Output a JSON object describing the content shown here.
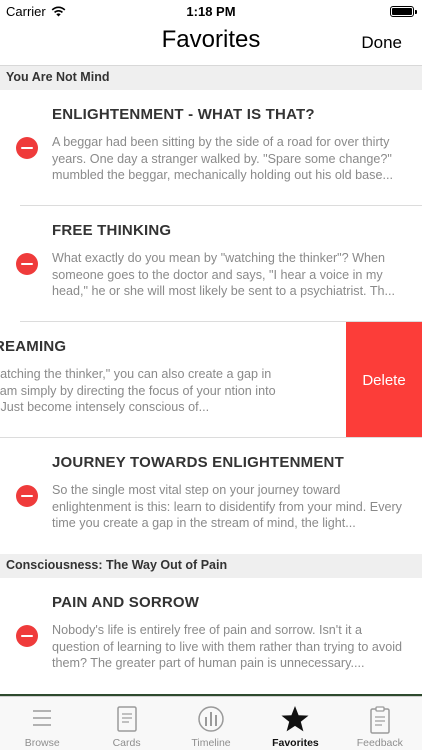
{
  "status": {
    "carrier": "Carrier",
    "time": "1:18 PM"
  },
  "nav": {
    "title": "Favorites",
    "done_label": "Done"
  },
  "sections": [
    {
      "header": "You Are Not Mind",
      "rows": [
        {
          "title": "ENLIGHTENMENT - WHAT IS THAT?",
          "text": "A beggar had been sitting by the side of a road for over thirty years. One day a stranger walked by. \"Spare some change?\" mumbled the beggar, mechanically holding out his old base..."
        },
        {
          "title": "FREE THINKING",
          "text": "What exactly do you mean by \"watching the thinker\"? When someone goes to the doctor and says, \"I hear a voice in my head,\" he or she will most likely be sent to a psychiatrist. Th..."
        },
        {
          "title": "ND STREAMING",
          "text": "ead of \"watching the thinker,\" you can also create a gap in mind stream simply by directing the focus of your ntion into the Now. Just become intensely conscious of...",
          "delete_label": "Delete"
        },
        {
          "title": "JOURNEY TOWARDS ENLIGHTENMENT",
          "text": "So the single most vital step on your journey toward enlightenment is this: learn to disidentify from your mind. Every time you create a gap in the stream of mind, the light..."
        }
      ]
    },
    {
      "header": "Consciousness: The Way Out of Pain",
      "rows": [
        {
          "title": "PAIN AND SORROW",
          "text": "Nobody's life is entirely free of pain and sorrow. Isn't it a question of learning to live with them rather than trying to avoid them? The greater part of human pain is unnecessary...."
        }
      ]
    }
  ],
  "tabs": [
    {
      "label": "Browse",
      "icon": "list-icon"
    },
    {
      "label": "Cards",
      "icon": "card-icon"
    },
    {
      "label": "Timeline",
      "icon": "timeline-icon"
    },
    {
      "label": "Favorites",
      "icon": "star-icon",
      "active": true
    },
    {
      "label": "Feedback",
      "icon": "clipboard-icon"
    }
  ],
  "colors": {
    "delete": "#fc3d39",
    "minus": "#ef3b3b",
    "tab_active": "#111111",
    "tab_inactive": "#8e8e8e"
  }
}
